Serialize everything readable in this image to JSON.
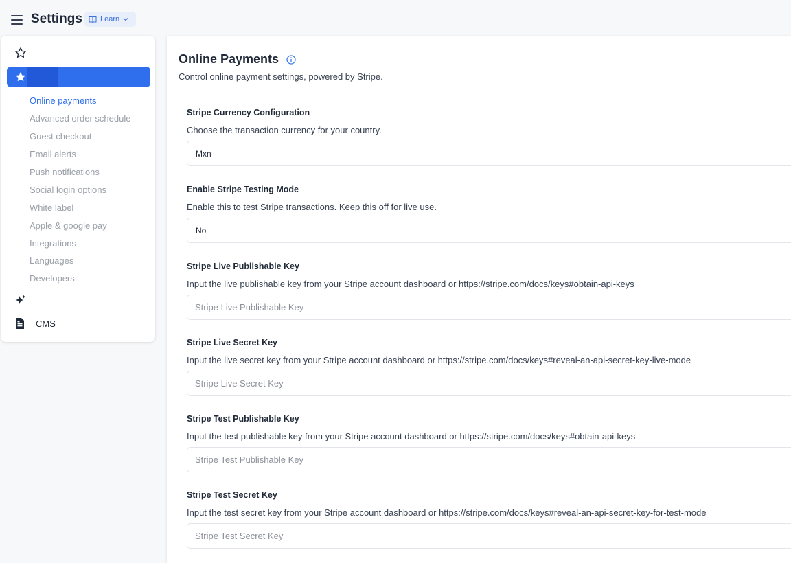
{
  "header": {
    "title": "Settings",
    "learn_label": "Learn"
  },
  "sidebar": {
    "active_item_label": "",
    "sub_items": [
      "Online payments",
      "Advanced order schedule",
      "Guest checkout",
      "Email alerts",
      "Push notifications",
      "Social login options",
      "White label",
      "Apple & google pay",
      "Integrations",
      "Languages",
      "Developers"
    ],
    "cms_label": "CMS",
    "accent_color": "#2f6fed"
  },
  "main": {
    "title": "Online Payments",
    "description": "Control online payment settings, powered by Stripe.",
    "fields": [
      {
        "label": "Stripe Currency Configuration",
        "help": "Choose the transaction currency for your country.",
        "type": "select",
        "value": "Mxn"
      },
      {
        "label": "Enable Stripe Testing Mode",
        "help": "Enable this to test Stripe transactions. Keep this off for live use.",
        "type": "select",
        "value": "No"
      },
      {
        "label": "Stripe Live Publishable Key",
        "help": "Input the live publishable key from your Stripe account dashboard or https://stripe.com/docs/keys#obtain-api-keys",
        "type": "input",
        "placeholder": "Stripe Live Publishable Key"
      },
      {
        "label": "Stripe Live Secret Key",
        "help": "Input the live secret key from your Stripe account dashboard or https://stripe.com/docs/keys#reveal-an-api-secret-key-live-mode",
        "type": "input",
        "placeholder": "Stripe Live Secret Key"
      },
      {
        "label": "Stripe Test Publishable Key",
        "help": "Input the test publishable key from your Stripe account dashboard or https://stripe.com/docs/keys#obtain-api-keys",
        "type": "input",
        "placeholder": "Stripe Test Publishable Key"
      },
      {
        "label": "Stripe Test Secret Key",
        "help": "Input the test secret key from your Stripe account dashboard or https://stripe.com/docs/keys#reveal-an-api-secret-key-for-test-mode",
        "type": "input",
        "placeholder": "Stripe Test Secret Key"
      }
    ]
  }
}
